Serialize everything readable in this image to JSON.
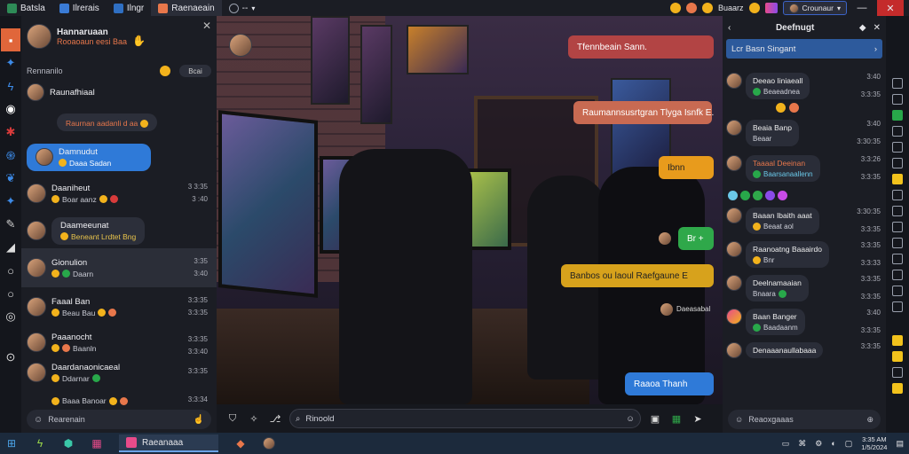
{
  "topbar": {
    "tabs": [
      {
        "label": "Batsla",
        "icon": "grid-icon",
        "color": "#2e8b57"
      },
      {
        "label": "Ilrerais",
        "icon": "app-icon",
        "color": "#3a7bd5"
      },
      {
        "label": "Ilngr",
        "icon": "app-icon",
        "color": "#2f6fc2"
      },
      {
        "label": "Raenaeain",
        "icon": "orange-app-icon",
        "color": "#e8774b"
      },
      {
        "label": "--",
        "icon": "chat-icon",
        "color": "#9aa0ad"
      }
    ],
    "right_label": "Buaarz",
    "profile_label": "Crounaur",
    "window_controls": {
      "minimize": "—",
      "maximize": "▢",
      "close": "✕"
    }
  },
  "chat_list": {
    "header": {
      "name": "Hannaruaan",
      "status": "Rooaoaun eesi Baa"
    },
    "close_label": "✕",
    "section_label": "Rennanilo",
    "section_pill": "Bcai",
    "items": [
      {
        "name": "Raunafhiaal",
        "preview": "Raurnan aadanli d aa",
        "time": "",
        "time2": ""
      },
      {
        "name": "Damnudut",
        "preview": "Daaa Sadan",
        "time": "",
        "time2": ""
      },
      {
        "name": "Daaniheut",
        "preview": "Boar aanz",
        "time": "3 3:35",
        "time2": "3 :40"
      },
      {
        "name": "Daameeunat",
        "preview": "Beneant  Lrdtet  Bng",
        "time": "3 3:00",
        "time2": ""
      },
      {
        "name": "Gionulion",
        "preview": "Daarn",
        "time": "3:35",
        "time2": "3:40"
      },
      {
        "name": "Faaal Ban",
        "preview": "Beau Bau",
        "time": "3:3:35",
        "time2": "3:3:35"
      },
      {
        "name": "Paaanocht",
        "preview": "Baanln",
        "time": "3:3:35",
        "time2": "3:3:40"
      },
      {
        "name": "Daardanaonicaeal",
        "preview": "Ddarnar",
        "time": "3:3:35",
        "time2": ""
      },
      {
        "name": "Berra Daaeauan",
        "preview": "Baaa Banoar",
        "time": "3:3:34",
        "time2": "3:3:30"
      }
    ],
    "input_placeholder": "Rearenain"
  },
  "stage": {
    "messages": [
      {
        "text": "Tfennbeain Sann.",
        "style": "red"
      },
      {
        "text": "Raumannsusrtgran Tlyga Isnfk E.",
        "style": "salmon"
      },
      {
        "text": "Ibnn",
        "style": "amber"
      },
      {
        "text": "Br +",
        "style": "green"
      },
      {
        "text": "Banbos ou laoul Raefgaune E",
        "style": "gold"
      },
      {
        "text": "Raaoa Thanh",
        "style": "blue"
      }
    ],
    "annotation": "Daeasabal"
  },
  "input_bar": {
    "placeholder": "Rinoold"
  },
  "right_panel": {
    "title": "Deefnugt",
    "banner": "Lcr Basn Singant",
    "items": [
      {
        "name": "Deeao Iiniaeall",
        "preview": "Beaeadnea",
        "time": "3:40",
        "time2": "3:3:35"
      },
      {
        "name": "Beaia Banp",
        "preview": "Beaar",
        "time": "3:40",
        "time2": "3:30:35"
      },
      {
        "name": "Taaaal Deeinan",
        "preview": "Baarsanaallenn",
        "time": "3:3:26",
        "time2": "3:3:35"
      },
      {
        "name": "Baaan Ibaith aaat",
        "preview": "Beaat aol",
        "time": "3:30:35",
        "time2": "3:3:35"
      },
      {
        "name": "Raanoatng Baaairdo",
        "preview": "Bnr",
        "time": "3:3:35",
        "time2": "3:3:33"
      },
      {
        "name": "Deelnamaaian",
        "preview": "Bnaara",
        "time": "3:3:35",
        "time2": "3:3:35"
      },
      {
        "name": "Baan Banger",
        "preview": "Baadaanm",
        "time": "3:40",
        "time2": "3:3:35"
      },
      {
        "name": "Denaaanaullabaaa",
        "preview": "",
        "time": "3:3:35",
        "time2": ""
      }
    ],
    "input_placeholder": "Reaoxgaaas"
  },
  "taskbar": {
    "app_label": "Raeanaaa",
    "clock_time": "3:35 AM",
    "clock_date": "1/5/2024"
  },
  "colors": {
    "accent": "#2f7ad8",
    "orange": "#e8774b",
    "panel": "#1b1d24"
  }
}
